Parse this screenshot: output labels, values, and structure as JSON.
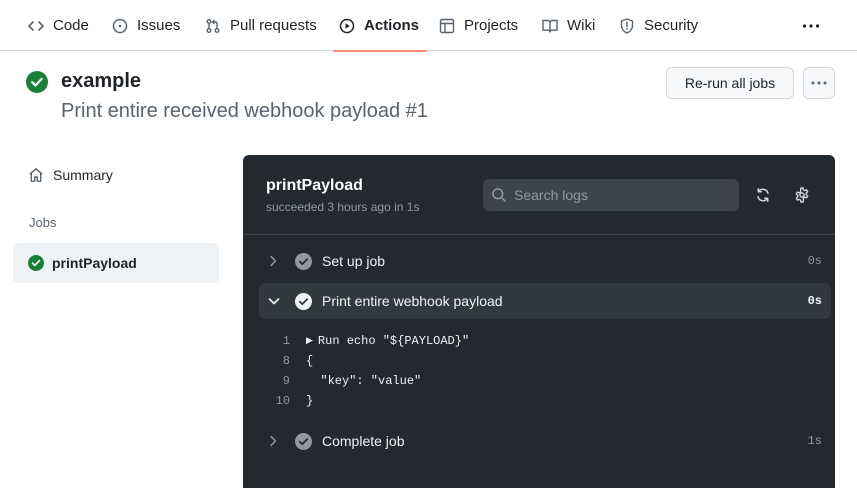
{
  "nav": {
    "tabs": [
      {
        "label": "Code",
        "icon": "code-icon"
      },
      {
        "label": "Issues",
        "icon": "issue-opened-icon"
      },
      {
        "label": "Pull requests",
        "icon": "git-pull-request-icon"
      },
      {
        "label": "Actions",
        "icon": "play-icon",
        "active": true
      },
      {
        "label": "Projects",
        "icon": "table-icon"
      },
      {
        "label": "Wiki",
        "icon": "book-icon"
      },
      {
        "label": "Security",
        "icon": "shield-icon"
      }
    ],
    "more_icon": "kebab-horizontal-icon",
    "active_underline_color": "#fd8c73"
  },
  "run": {
    "workflow_name": "example",
    "run_title": "Print entire received webhook payload #1",
    "status_icon": "check-circle-fill-icon",
    "status_color": "#1a7f37",
    "rerun_label": "Re-run all jobs",
    "menu_icon": "kebab-horizontal-icon"
  },
  "sidebar": {
    "summary_label": "Summary",
    "jobs_heading": "Jobs",
    "jobs": [
      {
        "name": "printPayload",
        "status_icon": "check-circle-fill-icon",
        "selected": true
      }
    ]
  },
  "log": {
    "job_name": "printPayload",
    "job_status": "succeeded 3 hours ago in 1s",
    "search_placeholder": "Search logs",
    "panel_bg": "#24292f",
    "steps": [
      {
        "name": "Set up job",
        "duration": "0s",
        "expanded": false
      },
      {
        "name": "Print entire webhook payload",
        "duration": "0s",
        "expanded": true,
        "lines": [
          {
            "num": "1",
            "text": "Run echo \"${PAYLOAD}\"",
            "collapsible": true
          },
          {
            "num": "8",
            "text": "{"
          },
          {
            "num": "9",
            "text": "  \"key\": \"value\""
          },
          {
            "num": "10",
            "text": "}"
          }
        ]
      },
      {
        "name": "Complete job",
        "duration": "1s",
        "expanded": false
      }
    ]
  }
}
